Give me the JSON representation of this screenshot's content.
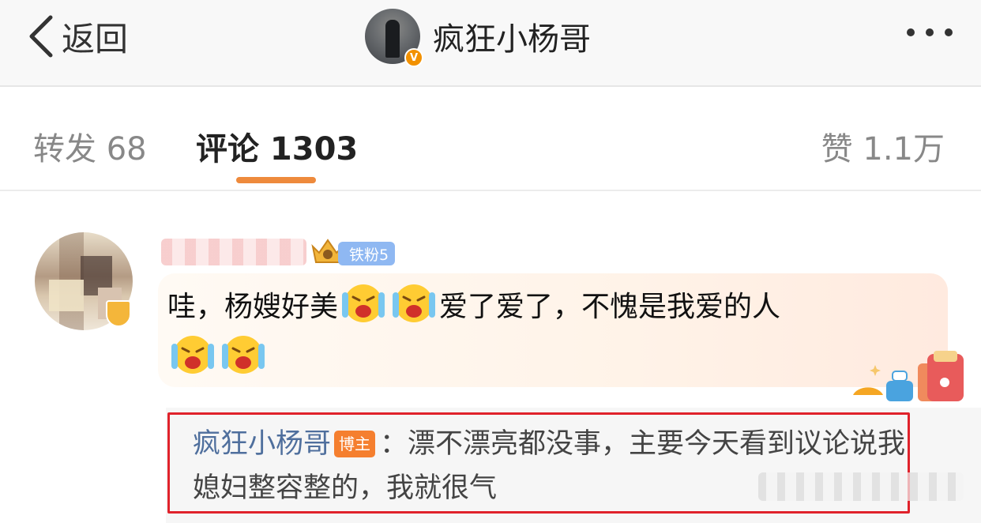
{
  "header": {
    "back_label": "返回",
    "title": "疯狂小杨哥",
    "verified_mark": "V",
    "icons": {
      "back": "chevron-left-icon",
      "more": "more-dots-icon",
      "verified": "verified-badge-icon"
    }
  },
  "tabs": {
    "repost": "转发 68",
    "comments": "评论 1303",
    "likes": "赞 1.1万",
    "active": "comments",
    "accent_color": "#ee8a3c"
  },
  "comment": {
    "fan_badge": "铁粉5",
    "text_part1": "哇，杨嫂好美",
    "text_part2": "爱了爱了，不愧是我爱的人",
    "emoji_name": "laugh-cry-emoji"
  },
  "reply": {
    "author": "疯狂小杨哥",
    "author_badge": "博主",
    "separator": "：",
    "text": "漂不漂亮都没事，主要今天看到议论说我媳妇整容整的，我就很气",
    "highlight_color": "#e0222b"
  }
}
